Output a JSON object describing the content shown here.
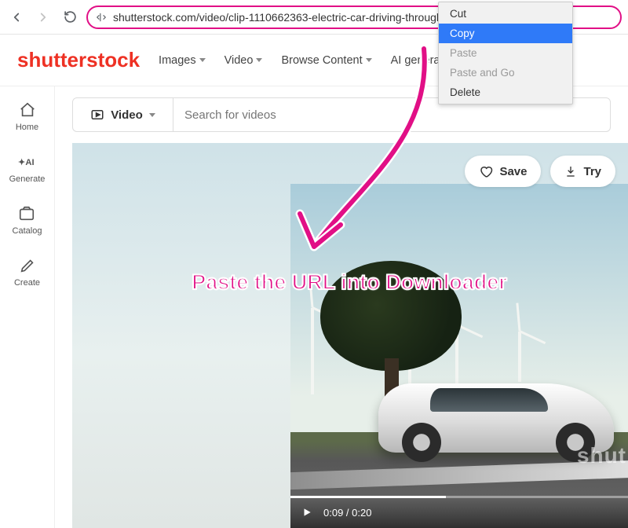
{
  "browser": {
    "url": "shutterstock.com/video/clip-1110662363-electric-car-driving-through-landscape-solar-power",
    "site_toggle": "⇆"
  },
  "context_menu": {
    "items": [
      {
        "label": "Cut",
        "state": "normal"
      },
      {
        "label": "Copy",
        "state": "selected"
      },
      {
        "label": "Paste",
        "state": "disabled"
      },
      {
        "label": "Paste and Go",
        "state": "disabled"
      },
      {
        "label": "Delete",
        "state": "normal"
      }
    ]
  },
  "brand": "shutterstock",
  "top_nav": [
    {
      "label": "Images"
    },
    {
      "label": "Video"
    },
    {
      "label": "Browse Content"
    },
    {
      "label": "AI generator"
    }
  ],
  "sidebar": [
    {
      "label": "Home",
      "icon": "home"
    },
    {
      "label": "Generate",
      "icon": "ai"
    },
    {
      "label": "Catalog",
      "icon": "catalog"
    },
    {
      "label": "Create",
      "icon": "create"
    }
  ],
  "search": {
    "type_label": "Video",
    "placeholder": "Search for videos"
  },
  "stage_buttons": {
    "save": "Save",
    "try": "Try"
  },
  "video": {
    "time": "0:09 / 0:20",
    "watermark": "shut"
  },
  "annotation": "Paste the URL into Downloader",
  "colors": {
    "accent": "#e10f86",
    "brand": "#ee3124",
    "menu_highlight": "#2f7af8"
  }
}
